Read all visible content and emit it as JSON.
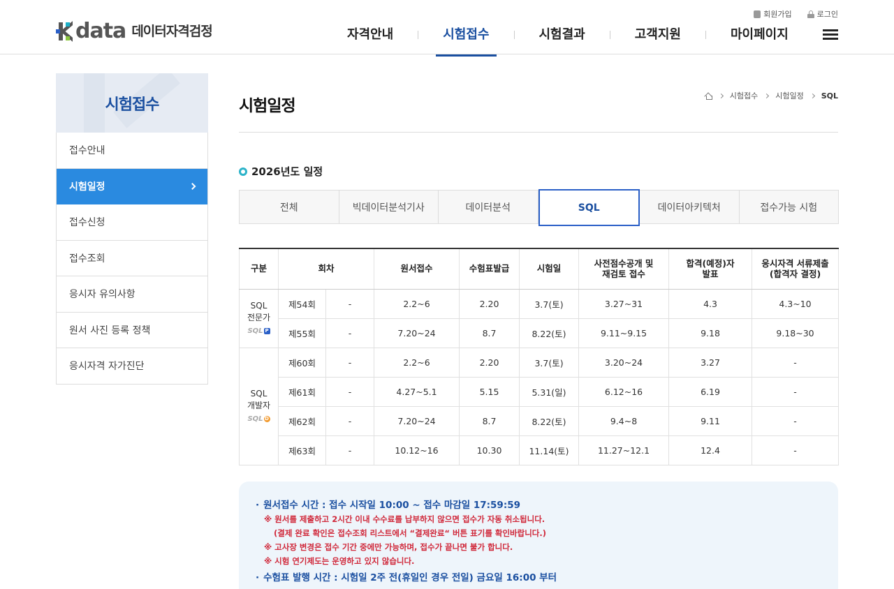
{
  "header": {
    "logo_word": "data",
    "logo_sub": "데이터자격검정",
    "util": [
      "회원가입",
      "로그인"
    ],
    "nav": [
      "자격안내",
      "시험접수",
      "시험결과",
      "고객지원",
      "마이페이지"
    ],
    "nav_active": 1
  },
  "sidebar": {
    "title": "시험접수",
    "items": [
      "접수안내",
      "시험일정",
      "접수신청",
      "접수조회",
      "응시자 유의사항",
      "원서 사진 등록 정책",
      "응시자격 자가진단"
    ],
    "active": 1
  },
  "content": {
    "title": "시험일정",
    "breadcrumb": [
      "시험접수",
      "시험일정",
      "SQL"
    ],
    "year_heading": "2026년도 일정",
    "tabs": [
      "전체",
      "빅데이터분석기사",
      "데이터분석",
      "SQL",
      "데이터아키텍처",
      "접수가능 시험"
    ],
    "tab_active": 3
  },
  "table": {
    "headers": [
      "구분",
      "회차",
      "원서접수",
      "수험표발급",
      "시험일",
      "사전점수공개 및 재검토 접수",
      "합격(예정)자 발표",
      "응시자격 서류제출 (합격자 결정)"
    ],
    "groups": [
      {
        "name_line1": "SQL",
        "name_line2": "전문가",
        "badge": "SQL",
        "badge_mark": "P",
        "rows": [
          [
            "제54회",
            "-",
            "2.2~6",
            "2.20",
            "3.7(토)",
            "3.27~31",
            "4.3",
            "4.3~10"
          ],
          [
            "제55회",
            "-",
            "7.20~24",
            "8.7",
            "8.22(토)",
            "9.11~9.15",
            "9.18",
            "9.18~30"
          ]
        ]
      },
      {
        "name_line1": "SQL",
        "name_line2": "개발자",
        "badge": "SQL",
        "badge_mark": "D",
        "rows": [
          [
            "제60회",
            "-",
            "2.2~6",
            "2.20",
            "3.7(토)",
            "3.20~24",
            "3.27",
            "-"
          ],
          [
            "제61회",
            "-",
            "4.27~5.1",
            "5.15",
            "5.31(일)",
            "6.12~16",
            "6.19",
            "-"
          ],
          [
            "제62회",
            "-",
            "7.20~24",
            "8.7",
            "8.22(토)",
            "9.4~8",
            "9.11",
            "-"
          ],
          [
            "제63회",
            "-",
            "10.12~16",
            "10.30",
            "11.14(토)",
            "11.27~12.1",
            "12.4",
            "-"
          ]
        ]
      }
    ]
  },
  "notice": {
    "main1": "원서접수 시간 : 접수 시작일 10:00 ~ 접수 마감일 17:59:59",
    "subs": [
      "※ 원서를 제출하고 2시간 이내 수수료를 납부하지 않으면 접수가 자동 취소됩니다.",
      "(결제 완료 확인은 접수조회 리스트에서 “결제완료“ 버튼 표기를 확인바랍니다.)",
      "※ 고사장 변경은 접수 기간 중에만 가능하며, 접수가 끝나면 불가 합니다.",
      "※ 시험 연기제도는 운영하고 있지 않습니다."
    ],
    "main2": "수험표 발행 시간 : 시험일 2주 전(휴일인 경우 전일) 금요일 16:00 부터",
    "bullet": "·"
  }
}
